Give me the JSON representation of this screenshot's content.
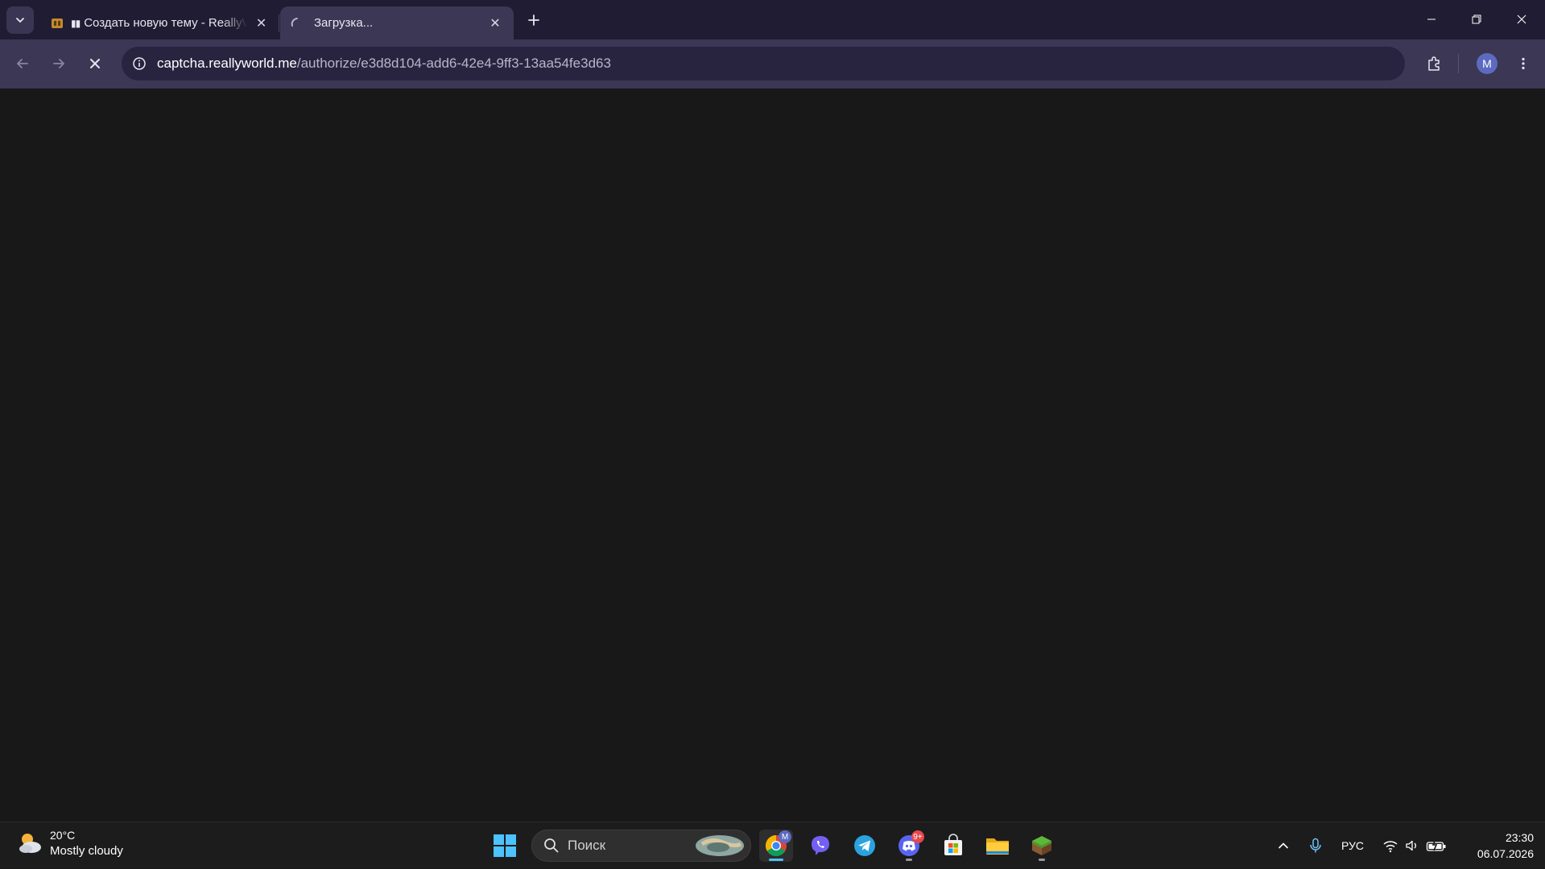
{
  "browser": {
    "tabs": [
      {
        "title": "Создать новую тему - ReallyWorld",
        "state": "inactive"
      },
      {
        "title": "Загрузка...",
        "state": "loading"
      }
    ],
    "address_host": "captcha.reallyworld.me",
    "address_path": "/authorize/e3d8d104-add6-42e4-9ff3-13aa54fe3d63",
    "profile_initial": "M"
  },
  "taskbar": {
    "weather": {
      "temp": "20°C",
      "desc": "Mostly cloudy"
    },
    "search_placeholder": "Поиск",
    "chrome_badge": "M",
    "discord_badge": "9+",
    "language": "РУС",
    "time": "23:30",
    "date": "06.07.2026"
  },
  "colors": {
    "tabstrip": "#201c33",
    "toolbar": "#3c3755",
    "omnibox": "#282440",
    "page": "#181818",
    "taskbar": "#1c1c1c",
    "accent": "#5c6bc0"
  }
}
